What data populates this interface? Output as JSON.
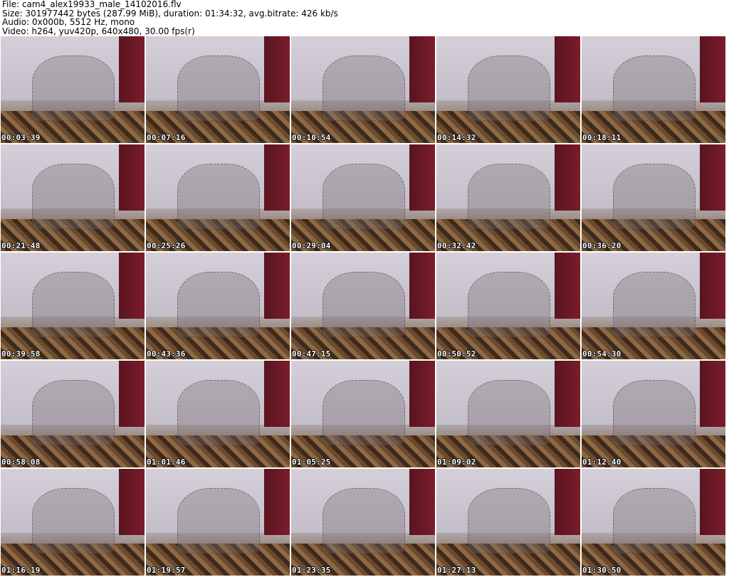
{
  "header": {
    "file": "File: cam4_alex19933_male_14102016.flv",
    "size": "Size: 301977442 bytes (287.99 MiB), duration: 01:34:32, avg.bitrate: 426 kb/s",
    "audio": "Audio: 0x000b, 5512 Hz, mono",
    "video": "Video: h264, yuv420p, 640x480, 30.00 fps(r)"
  },
  "frames": [
    "00:03:39",
    "00:07:16",
    "00:10:54",
    "00:14:32",
    "00:18:11",
    "00:21:48",
    "00:25:26",
    "00:29:04",
    "00:32:42",
    "00:36:20",
    "00:39:58",
    "00:43:36",
    "00:47:15",
    "00:50:52",
    "00:54:30",
    "00:58:08",
    "01:01:46",
    "01:05:25",
    "01:09:02",
    "01:12:40",
    "01:16:19",
    "01:19:57",
    "01:23:35",
    "01:27:13",
    "01:30:50"
  ]
}
